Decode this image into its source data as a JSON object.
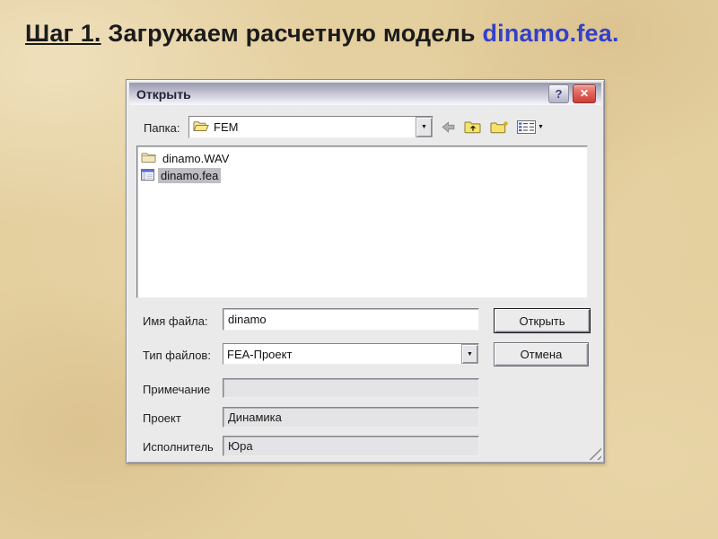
{
  "slide": {
    "title_step": "Шаг 1.",
    "title_text": " Загружаем расчетную модель ",
    "title_file": "dinamo.fea."
  },
  "dialog": {
    "title": "Открыть",
    "folder_row": {
      "label": "Папка:",
      "value": "FEM"
    },
    "toolbar": {
      "back": "back-arrow",
      "up": "up-one-level-folder",
      "new_folder": "create-new-folder",
      "views": "view-menu"
    },
    "files": [
      {
        "name": "dinamo.WAV",
        "icon": "folder-icon",
        "selected": false
      },
      {
        "name": "dinamo.fea",
        "icon": "fea-file-icon",
        "selected": true
      }
    ],
    "fields": [
      {
        "label": "Имя файла:",
        "value": "dinamo",
        "type": "text"
      },
      {
        "label": "Тип файлов:",
        "value": "FEA-Проект",
        "type": "dropdown"
      },
      {
        "label": "Примечание",
        "value": "",
        "type": "readonly"
      },
      {
        "label": "Проект",
        "value": "Динамика",
        "type": "readonly"
      },
      {
        "label": "Исполнитель",
        "value": "Юра",
        "type": "readonly"
      }
    ],
    "buttons": [
      {
        "label": "Открыть",
        "default": true
      },
      {
        "label": "Отмена",
        "default": false
      }
    ]
  },
  "icons": {
    "help": "?",
    "close": "✕",
    "dropdown_arrow": "▼",
    "views_arrow": "▼"
  },
  "colors": {
    "slide_background": "#e4cf9f",
    "title_link_blue": "#3340c8",
    "titlebar_gradient_top": "#9899ad",
    "titlebar_gradient_bottom": "#f8f8fb",
    "close_button_red": "#cc4038",
    "selection_gray": "#bdbdc2",
    "dialog_background": "#ebeaea"
  }
}
